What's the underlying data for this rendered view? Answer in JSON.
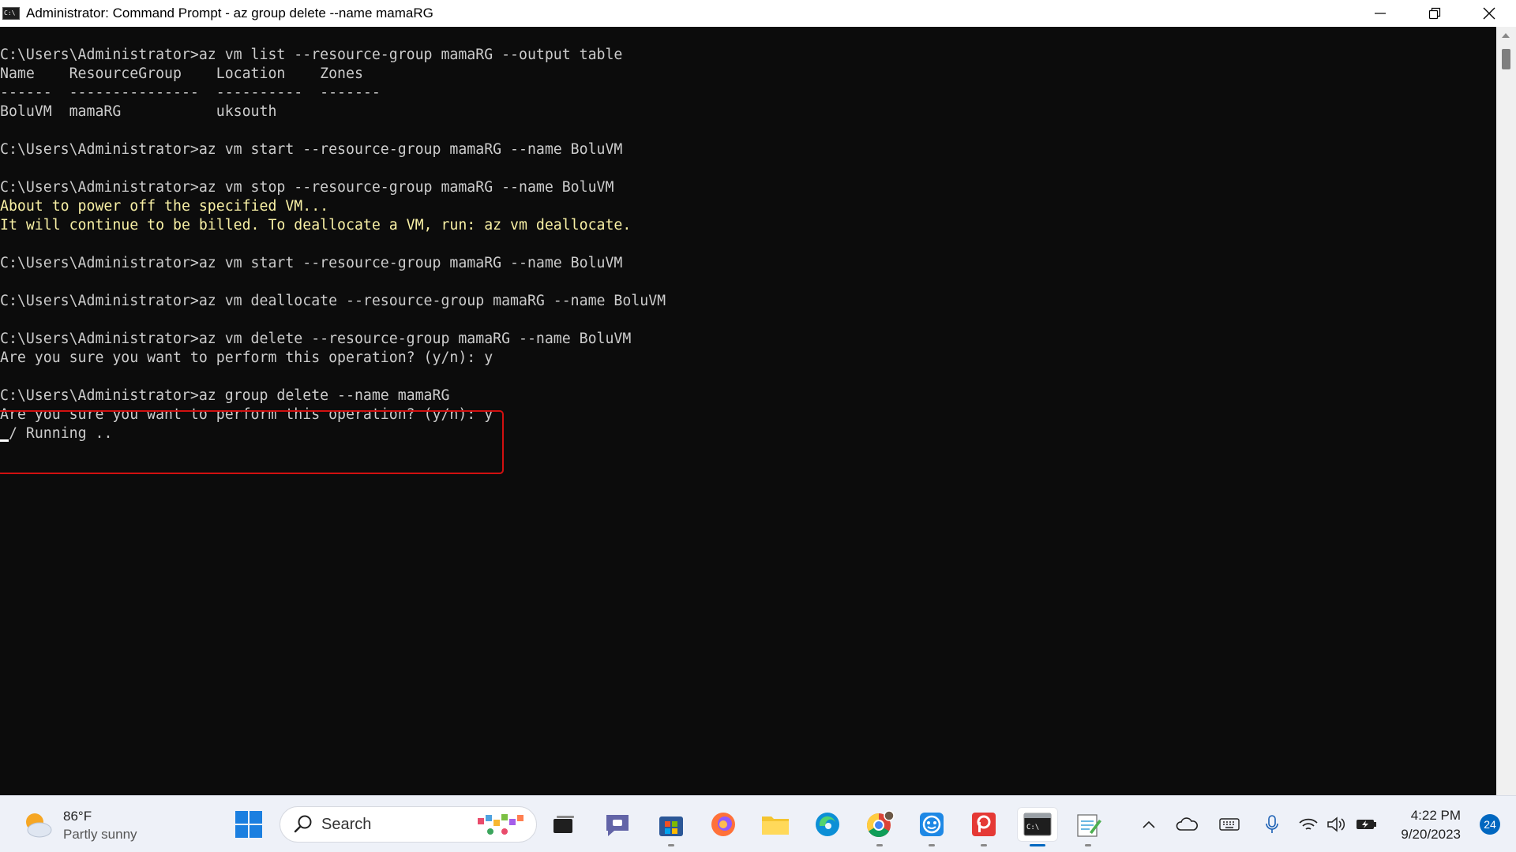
{
  "window": {
    "title": "Administrator: Command Prompt - az  group delete --name mamaRG",
    "controls": [
      "minimize",
      "restore",
      "close"
    ]
  },
  "console": {
    "lines": [
      {
        "text": "C:\\Users\\Administrator>az vm list --resource-group mamaRG --output table",
        "style": "normal"
      },
      {
        "text": "Name    ResourceGroup    Location    Zones",
        "style": "normal"
      },
      {
        "text": "------  ---------------  ----------  -------",
        "style": "normal"
      },
      {
        "text": "BoluVM  mamaRG           uksouth",
        "style": "normal"
      },
      {
        "text": "",
        "style": "normal"
      },
      {
        "text": "C:\\Users\\Administrator>az vm start --resource-group mamaRG --name BoluVM",
        "style": "normal"
      },
      {
        "text": "",
        "style": "normal"
      },
      {
        "text": "C:\\Users\\Administrator>az vm stop --resource-group mamaRG --name BoluVM",
        "style": "normal"
      },
      {
        "text": "About to power off the specified VM...",
        "style": "warn"
      },
      {
        "text": "It will continue to be billed. To deallocate a VM, run: az vm deallocate.",
        "style": "warn"
      },
      {
        "text": "",
        "style": "normal"
      },
      {
        "text": "C:\\Users\\Administrator>az vm start --resource-group mamaRG --name BoluVM",
        "style": "normal"
      },
      {
        "text": "",
        "style": "normal"
      },
      {
        "text": "C:\\Users\\Administrator>az vm deallocate --resource-group mamaRG --name BoluVM",
        "style": "normal"
      },
      {
        "text": "",
        "style": "normal"
      },
      {
        "text": "C:\\Users\\Administrator>az vm delete --resource-group mamaRG --name BoluVM",
        "style": "normal"
      },
      {
        "text": "Are you sure you want to perform this operation? (y/n): y",
        "style": "normal"
      },
      {
        "text": "",
        "style": "normal"
      },
      {
        "text": "C:\\Users\\Administrator>az group delete --name mamaRG",
        "style": "normal"
      },
      {
        "text": "Are you sure you want to perform this operation? (y/n): y",
        "style": "normal"
      },
      {
        "text": "/ Running ..",
        "style": "normal"
      }
    ]
  },
  "taskbar": {
    "weather": {
      "temp": "86°F",
      "condition": "Partly sunny"
    },
    "search_label": "Search",
    "clock": {
      "time": "4:22 PM",
      "date": "9/20/2023"
    },
    "notification_count": "24"
  }
}
